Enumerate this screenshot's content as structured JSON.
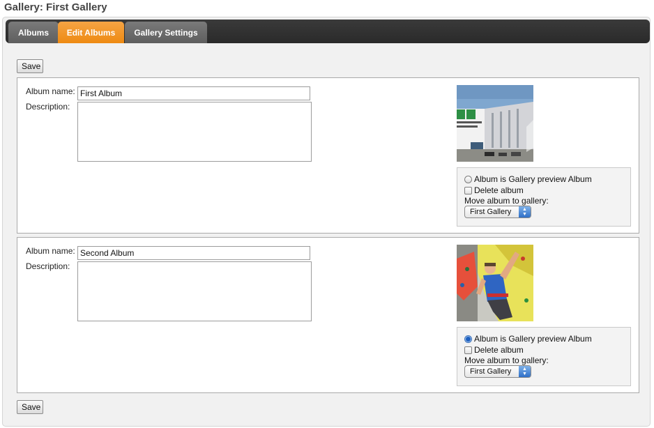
{
  "page": {
    "title": "Gallery: First Gallery"
  },
  "tabs": [
    {
      "label": "Albums",
      "active": false
    },
    {
      "label": "Edit Albums",
      "active": true
    },
    {
      "label": "Gallery Settings",
      "active": false
    }
  ],
  "save_label": "Save",
  "albums": [
    {
      "name_label": "Album name:",
      "name_value": "First Album",
      "description_label": "Description:",
      "description_value": "",
      "thumb_icon": "building-photo-icon",
      "preview_option": "Album is Gallery preview Album",
      "preview_checked": false,
      "delete_option": "Delete album",
      "delete_checked": false,
      "move_label": "Move album to gallery:",
      "move_selected": "First Gallery"
    },
    {
      "name_label": "Album name:",
      "name_value": "Second Album",
      "description_label": "Description:",
      "description_value": "",
      "thumb_icon": "climber-photo-icon",
      "preview_option": "Album is Gallery preview Album",
      "preview_checked": true,
      "delete_option": "Delete album",
      "delete_checked": false,
      "move_label": "Move album to gallery:",
      "move_selected": "First Gallery"
    }
  ],
  "colors": {
    "active_tab": "#ee8a12",
    "tab_bar": "#2e2e2e",
    "inactive_tab": "#6a6a6a"
  }
}
